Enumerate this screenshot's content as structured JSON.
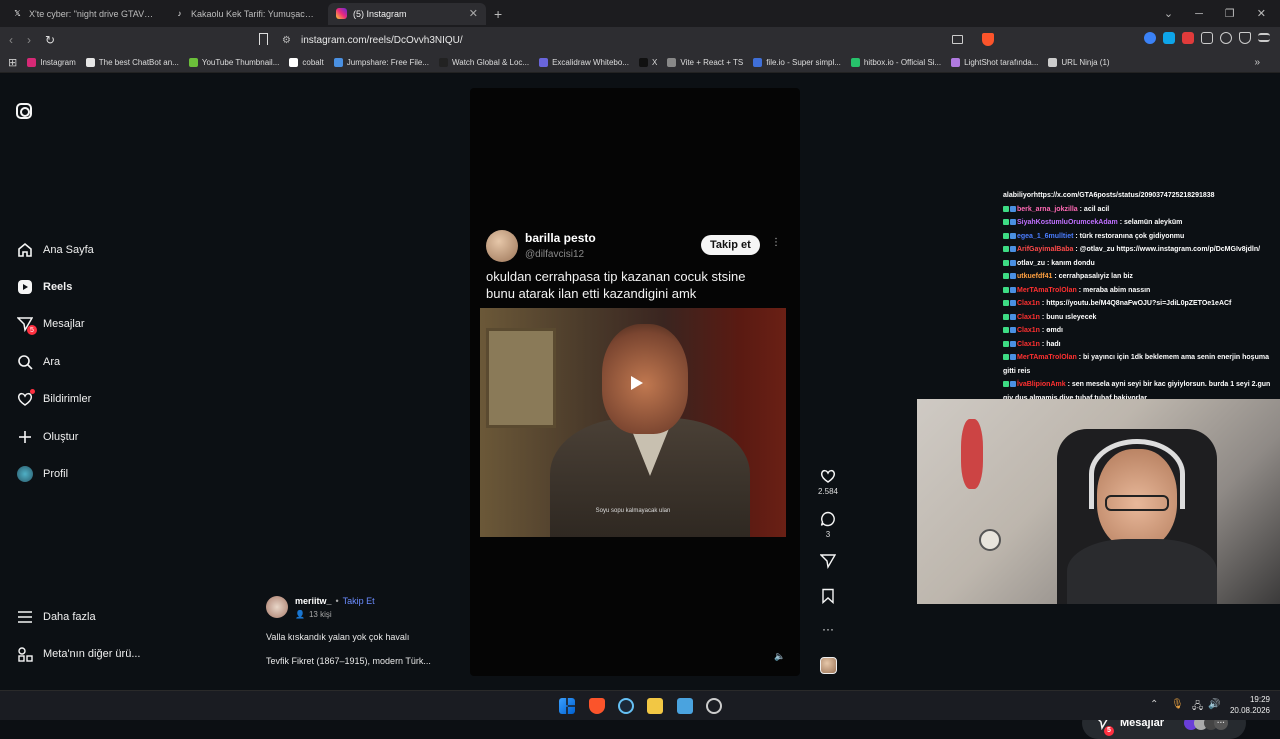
{
  "browser": {
    "tabs": [
      {
        "title": "X'te cyber: \"night drive GTAVI look in",
        "icon": "x-logo-icon",
        "active": false
      },
      {
        "title": "Kakaolu Kek Tarifi: Yumuşacık, Kolay",
        "icon": "tiktok-icon",
        "active": false
      },
      {
        "title": "(5) Instagram",
        "icon": "instagram-icon",
        "active": true
      }
    ],
    "new_tab": "+",
    "url": "instagram.com/reels/DcOvvh3NIQU/",
    "bookmarks": [
      {
        "label": "Instagram",
        "color": "#d62976"
      },
      {
        "label": "The best ChatBot an...",
        "color": "#e6e6e6"
      },
      {
        "label": "YouTube Thumbnail...",
        "color": "#6bbf3a"
      },
      {
        "label": "cobalt",
        "color": "#ffffff"
      },
      {
        "label": "Jumpshare: Free File...",
        "color": "#4a90e2"
      },
      {
        "label": "Watch Global & Loc...",
        "color": "#222222"
      },
      {
        "label": "Excalidraw Whitebo...",
        "color": "#6965db"
      },
      {
        "label": "X",
        "color": "#111111"
      },
      {
        "label": "Vite + React + TS",
        "color": "#888888"
      },
      {
        "label": "file.io - Super simpl...",
        "color": "#3f6fd8"
      },
      {
        "label": "hitbox.io - Official Si...",
        "color": "#27c26b"
      },
      {
        "label": "LightShot tarafında...",
        "color": "#b07ae0"
      },
      {
        "label": "URL Ninja (1)",
        "color": "#cccccc"
      }
    ]
  },
  "sidebar": {
    "items": [
      {
        "label": "Ana Sayfa",
        "icon": "home-icon"
      },
      {
        "label": "Reels",
        "icon": "reels-icon"
      },
      {
        "label": "Mesajlar",
        "icon": "messages-icon",
        "badge": "5"
      },
      {
        "label": "Ara",
        "icon": "search-icon"
      },
      {
        "label": "Bildirimler",
        "icon": "heart-icon"
      },
      {
        "label": "Oluştur",
        "icon": "plus-icon"
      },
      {
        "label": "Profil",
        "icon": "profile-avatar"
      }
    ],
    "more": "Daha fazla",
    "meta": "Meta'nın diğer ürü..."
  },
  "reel": {
    "tweet": {
      "name": "barilla pesto",
      "handle": "@dilfavcisi12",
      "follow": "Takip et",
      "text_line1": "okuldan cerrahpasa tip kazanan cocuk stsine",
      "text_line2": "bunu atarak ilan etti kazandigini amk"
    },
    "video_subtitle": "Soyu sopu kalmayacak ulan",
    "likes": "2.584",
    "comments": "3",
    "author": "meriitw_",
    "author_sep": "•",
    "author_follow": "Takip Et",
    "audience": "13 kişi",
    "caption_line1": "Valla kıskandık yalan yok çok havalı",
    "caption_line2": "Tevfik Fikret (1867–1915), modern Türk..."
  },
  "chat": [
    {
      "user": "alabiliyorhttps://x.com/GTA6posts/status/2090374725218291838",
      "color": "#ffffff",
      "msg": ""
    },
    {
      "user": "berk_arna_jokzilla",
      "color": "#ff69b4",
      "msg": " : acil acil"
    },
    {
      "user": "SiyahKostumluOrumcekAdam",
      "color": "#c070ff",
      "msg": " : selamün aleyküm"
    },
    {
      "user": "egea_1_6mulltiet",
      "color": "#4a7dff",
      "msg": " : türk restoranına çok gidiyonmu"
    },
    {
      "user": "ArifGayimalBaba",
      "color": "#ff4a4a",
      "msg": " : @otlav_zu https://www.instagram.com/p/DcMGIv8jdln/"
    },
    {
      "user": "otlav_zu",
      "color": "#ffffff",
      "msg": " : kanım dondu"
    },
    {
      "user": "utkuefdf41",
      "color": "#ffa040",
      "msg": " : cerrahpasalıyiz lan biz"
    },
    {
      "user": "MerTAmaTrolOlan",
      "color": "#ff3030",
      "msg": " : meraba abim nassın"
    },
    {
      "user": "Clax1n",
      "color": "#ff3030",
      "msg": " : https://youtu.be/M4Q8naFwOJU?si=JdiL0pZETOe1eACf"
    },
    {
      "user": "Clax1n",
      "color": "#ff3030",
      "msg": " : bunu ısleyecek"
    },
    {
      "user": "Clax1n",
      "color": "#ff3030",
      "msg": " : ɵmdı"
    },
    {
      "user": "Clax1n",
      "color": "#ff3030",
      "msg": " : hadı"
    },
    {
      "user": "MerTAmaTrolOlan",
      "color": "#ff3030",
      "msg": " : bi yayıncı için 1dk beklemem ama senin enerjin hoşuma"
    },
    {
      "user": "",
      "color": "#ffffff",
      "msg": "gitti reis"
    },
    {
      "user": "İvaBlipionAmk",
      "color": "#ff3030",
      "msg": " : sen mesela ayni seyi bir kac giyiylorsun. burda 1 seyi 2.gun"
    },
    {
      "user": "",
      "color": "#ffffff",
      "msg": "giy dus almamis diye tuhaf tuhaf bakiyorlar"
    }
  ],
  "messages_fab": {
    "label": "Mesajlar",
    "badge": "5"
  },
  "taskbar": {
    "time": "19:29",
    "date": "20.08.2026"
  }
}
